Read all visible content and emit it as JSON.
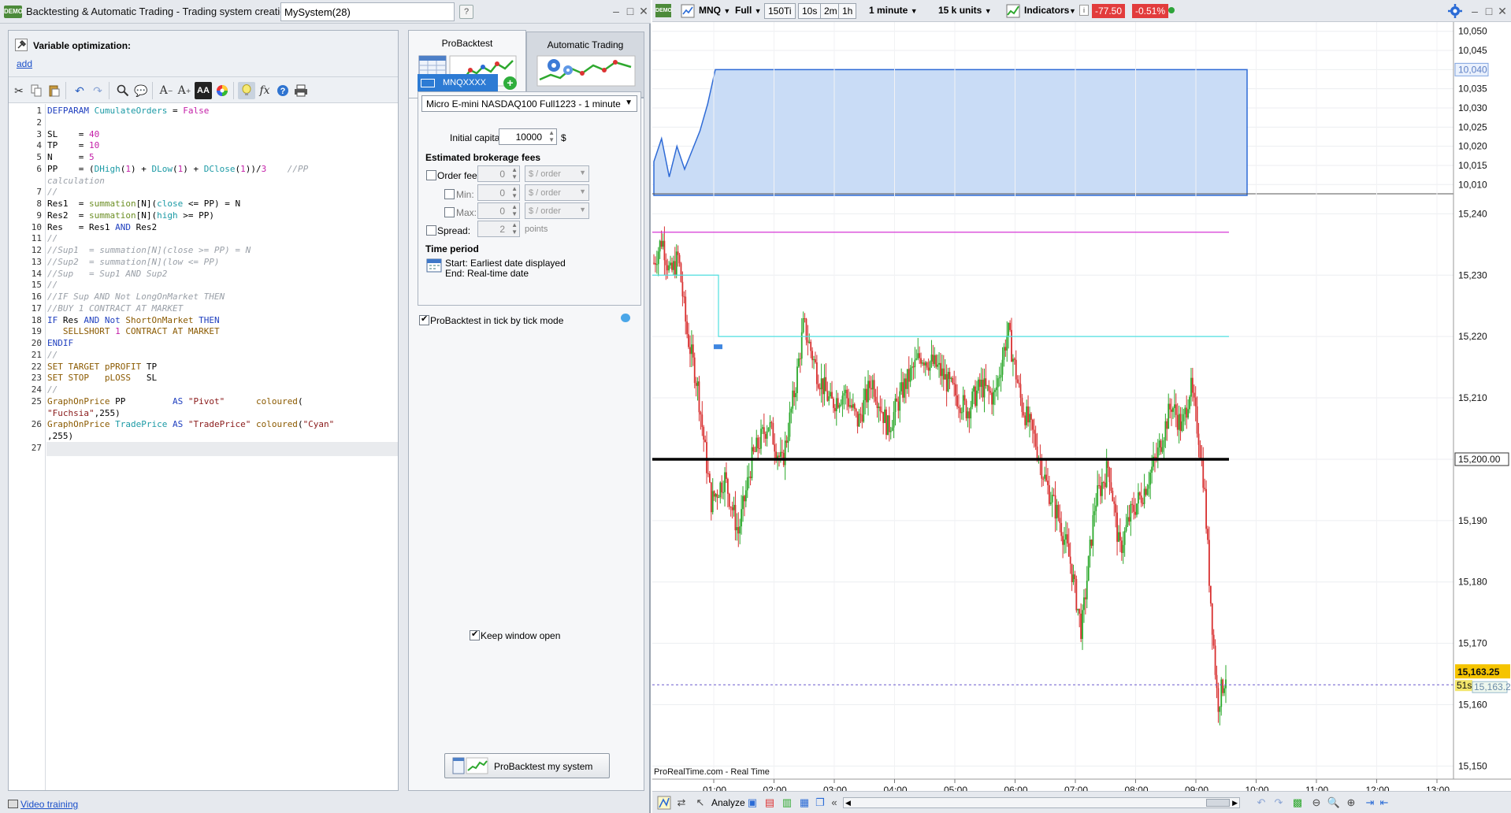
{
  "left_window": {
    "title": "Backtesting & Automatic Trading - Trading system creation",
    "system_name": "MySystem(28)",
    "controls": {
      "minimize": "–",
      "maximize": "□",
      "close": "✕"
    }
  },
  "editor": {
    "variable_optimization_label": "Variable optimization:",
    "add_link": "add",
    "video_training_link": "Video training",
    "lines": [
      {
        "n": "1",
        "html": "<span class='kw'>DEFPARAM</span> <span class='fn'>CumulateOrders</span> = <span class='num'>False</span>"
      },
      {
        "n": "2",
        "html": ""
      },
      {
        "n": "3",
        "html": "SL    = <span class='num'>40</span>"
      },
      {
        "n": "4",
        "html": "TP    = <span class='num'>10</span>"
      },
      {
        "n": "5",
        "html": "N     = <span class='num'>5</span>"
      },
      {
        "n": "6",
        "html": "PP    = (<span class='fn'>DHigh</span>(<span class='num'>1</span>) + <span class='fn'>DLow</span>(<span class='num'>1</span>) + <span class='fn'>DClose</span>(<span class='num'>1</span>))/<span class='num'>3</span>    <span class='cm'>//PP</span>"
      },
      {
        "n": "",
        "html": "<span class='cm'>calculation</span>"
      },
      {
        "n": "7",
        "html": "<span class='cm'>//</span>"
      },
      {
        "n": "8",
        "html": "Res1  = <span class='gr'>summation</span>[N](<span class='fn'>close</span> &lt;= PP) = N"
      },
      {
        "n": "9",
        "html": "Res2  = <span class='gr'>summation</span>[N](<span class='fn'>high</span> &gt;= PP)"
      },
      {
        "n": "10",
        "html": "Res   = Res1 <span class='kw'>AND</span> Res2"
      },
      {
        "n": "11",
        "html": "<span class='cm'>//</span>"
      },
      {
        "n": "12",
        "html": "<span class='cm'>//Sup1  = summation[N](close &gt;= PP) = N</span>"
      },
      {
        "n": "13",
        "html": "<span class='cm'>//Sup2  = summation[N](low &lt;= PP)</span>"
      },
      {
        "n": "14",
        "html": "<span class='cm'>//Sup   = Sup1 AND Sup2</span>"
      },
      {
        "n": "15",
        "html": "<span class='cm'>//</span>"
      },
      {
        "n": "16",
        "html": "<span class='cm'>//IF Sup AND Not LongOnMarket THEN</span>"
      },
      {
        "n": "17",
        "html": "<span class='cm'>//BUY 1 CONTRACT AT MARKET</span>"
      },
      {
        "n": "18",
        "html": "<span class='kw'>IF</span> Res <span class='kw'>AND</span> <span class='kw'>Not</span> <span class='br'>ShortOnMarket</span> <span class='kw'>THEN</span>"
      },
      {
        "n": "19",
        "html": "   <span class='br'>SELLSHORT</span> <span class='num'>1</span> <span class='br'>CONTRACT AT MARKET</span>"
      },
      {
        "n": "20",
        "html": "<span class='kw'>ENDIF</span>"
      },
      {
        "n": "21",
        "html": "<span class='cm'>//</span>"
      },
      {
        "n": "22",
        "html": "<span class='br'>SET TARGET pPROFIT</span> TP"
      },
      {
        "n": "23",
        "html": "<span class='br'>SET STOP   pLOSS</span>   SL"
      },
      {
        "n": "24",
        "html": "<span class='cm'>//</span>"
      },
      {
        "n": "25",
        "html": "<span class='br'>GraphOnPrice</span> PP         <span class='kw'>AS</span> <span class='str'>\"Pivot\"</span>      <span class='br'>coloured</span>("
      },
      {
        "n": "",
        "html": "<span class='str'>\"Fuchsia\"</span>,255)"
      },
      {
        "n": "26",
        "html": "<span class='br'>GraphOnPrice</span> <span class='fn'>TradePrice</span> <span class='kw'>AS</span> <span class='str'>\"TradePrice\"</span> <span class='br'>coloured</span>(<span class='str'>\"Cyan\"</span>"
      },
      {
        "n": "",
        "html": ",255)"
      },
      {
        "n": "27",
        "html": ""
      }
    ]
  },
  "backtest": {
    "tab_probacktest": "ProBacktest",
    "tab_automatic": "Automatic Trading",
    "instrument_tab": "MNQXXXX",
    "instrument_select": "Micro E-mini NASDAQ100 Full1223 - 1 minute",
    "initial_capital_label": "Initial capital:",
    "initial_capital_value": "10000",
    "currency": "$",
    "fees_heading": "Estimated brokerage fees",
    "order_fee_label": "Order fee :",
    "order_fee_value": "0",
    "per_order_unit": "$ / order",
    "min_label": "Min:",
    "min_value": "0",
    "max_label": "Max:",
    "max_value": "0",
    "spread_label": "Spread:",
    "spread_value": "2",
    "spread_unit": "points",
    "time_period_heading": "Time period",
    "start_label": "Start: Earliest date displayed",
    "end_label": "End:  Real-time date",
    "tick_mode_label": "ProBacktest in tick by tick mode",
    "keep_open_label": "Keep window open",
    "run_button": "ProBacktest my system"
  },
  "chart_window": {
    "toolbar": {
      "symbol": "MNQ",
      "view": "Full",
      "tf_150ti": "150Ti",
      "tf_10s": "10s",
      "tf_2m": "2m",
      "tf_1h": "1h",
      "interval": "1 minute",
      "units": "15 k units",
      "indicators": "Indicators",
      "pnl": "-77.50",
      "pct": "-0.51%"
    },
    "source_label": "ProRealTime.com - Real Time",
    "analyze_label": "Analyze",
    "countdown": "51s",
    "colors": {
      "pivot": "#d636d6",
      "trade": "#4fe0e0",
      "equity_fill": "#c9dcf6",
      "up": "#2aa82a",
      "down": "#d83030",
      "last": "#f5c400"
    }
  },
  "chart_data": [
    {
      "type": "area",
      "title": "",
      "y_ticks": [
        "10,050",
        "10,045",
        "10,040",
        "10,035",
        "10,030",
        "10,025",
        "10,020",
        "10,015",
        "10,010"
      ],
      "ylim": [
        10008,
        10052
      ],
      "current_value_label": "10,040",
      "series": [
        {
          "values": [
            10016,
            10022,
            10012,
            10020,
            10014,
            10019,
            10024,
            10031,
            10040,
            10040
          ]
        }
      ]
    },
    {
      "type": "candlestick",
      "title": "",
      "y_ticks": [
        "15,240",
        "15,230",
        "15,220",
        "15,210",
        "15,200",
        "15,190",
        "15,180",
        "15,170",
        "15,160",
        "15,150"
      ],
      "ylim": [
        15148,
        15243
      ],
      "x_ticks": [
        "01:00",
        "02:00",
        "03:00",
        "04:00",
        "05:00",
        "06:00",
        "07:00",
        "08:00",
        "09:00",
        "10:00",
        "11:00",
        "12:00",
        "13:00"
      ],
      "pivot_level": 15237,
      "pivot_color": "#d636d6",
      "trade_price_levels": [
        15230,
        15220
      ],
      "trade_price_color": "#4fe0e0",
      "marked_level_label": "15,200.00",
      "marked_level": 15200,
      "last_price_label": "15,163.25",
      "last_price": 15163.25,
      "path": [
        [
          0.0,
          15232
        ],
        [
          0.15,
          15236
        ],
        [
          0.3,
          15230
        ],
        [
          0.45,
          15233
        ],
        [
          0.6,
          15221
        ],
        [
          0.8,
          15212
        ],
        [
          1.05,
          15193
        ],
        [
          1.3,
          15197
        ],
        [
          1.55,
          15188
        ],
        [
          1.8,
          15200
        ],
        [
          2.1,
          15206
        ],
        [
          2.35,
          15199
        ],
        [
          2.6,
          15212
        ],
        [
          2.75,
          15222
        ],
        [
          3.0,
          15214
        ],
        [
          3.25,
          15209
        ],
        [
          3.5,
          15211
        ],
        [
          3.75,
          15206
        ],
        [
          4.0,
          15213
        ],
        [
          4.3,
          15205
        ],
        [
          4.6,
          15212
        ],
        [
          4.9,
          15217
        ],
        [
          5.2,
          15215
        ],
        [
          5.5,
          15211
        ],
        [
          5.75,
          15208
        ],
        [
          6.0,
          15212
        ],
        [
          6.25,
          15210
        ],
        [
          6.5,
          15221
        ],
        [
          6.75,
          15209
        ],
        [
          7.0,
          15203
        ],
        [
          7.2,
          15196
        ],
        [
          7.45,
          15190
        ],
        [
          7.65,
          15183
        ],
        [
          7.85,
          15172
        ],
        [
          8.1,
          15193
        ],
        [
          8.35,
          15199
        ],
        [
          8.55,
          15185
        ],
        [
          8.75,
          15191
        ],
        [
          9.0,
          15195
        ],
        [
          9.25,
          15201
        ],
        [
          9.5,
          15209
        ],
        [
          9.7,
          15205
        ],
        [
          9.85,
          15212
        ],
        [
          10.0,
          15204
        ],
        [
          10.1,
          15196
        ],
        [
          10.2,
          15180
        ],
        [
          10.35,
          15160
        ],
        [
          10.5,
          15165
        ]
      ]
    }
  ]
}
